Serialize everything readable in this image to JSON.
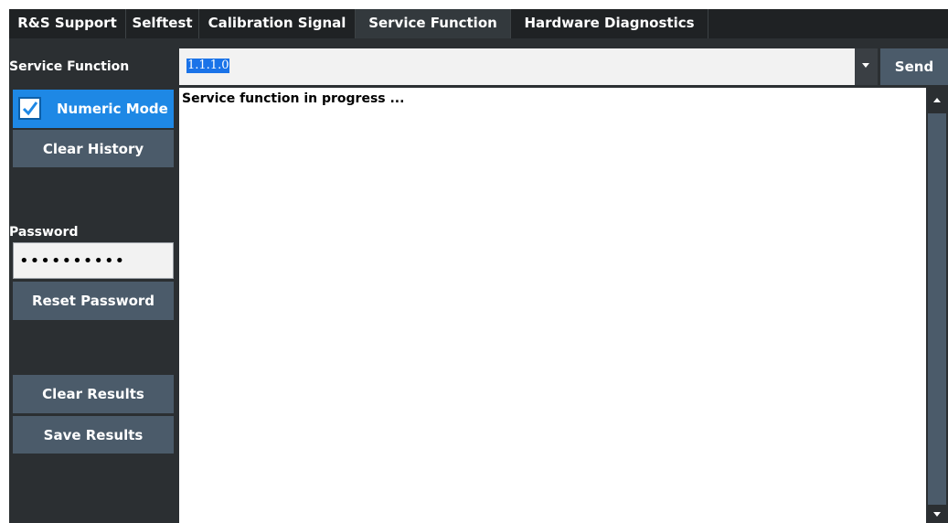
{
  "tabs": [
    {
      "label": "R&S Support"
    },
    {
      "label": "Selftest"
    },
    {
      "label": "Calibration Signal"
    },
    {
      "label": "Service Function",
      "active": true
    },
    {
      "label": "Hardware Diagnostics"
    }
  ],
  "left": {
    "service_function_label": "Service Function",
    "numeric_mode_label": "Numeric Mode",
    "numeric_mode_checked": true,
    "clear_history_label": "Clear History",
    "password_label": "Password",
    "password_value": "••••••••••",
    "reset_password_label": "Reset Password",
    "clear_results_label": "Clear Results",
    "save_results_label": "Save Results"
  },
  "function_input": {
    "value": "1.1.1.0"
  },
  "send_label": "Send",
  "output": {
    "text": "Service function in progress ..."
  },
  "colors": {
    "accent": "#1e88e5",
    "button": "#4b5b6a",
    "background": "#2b2f32"
  }
}
